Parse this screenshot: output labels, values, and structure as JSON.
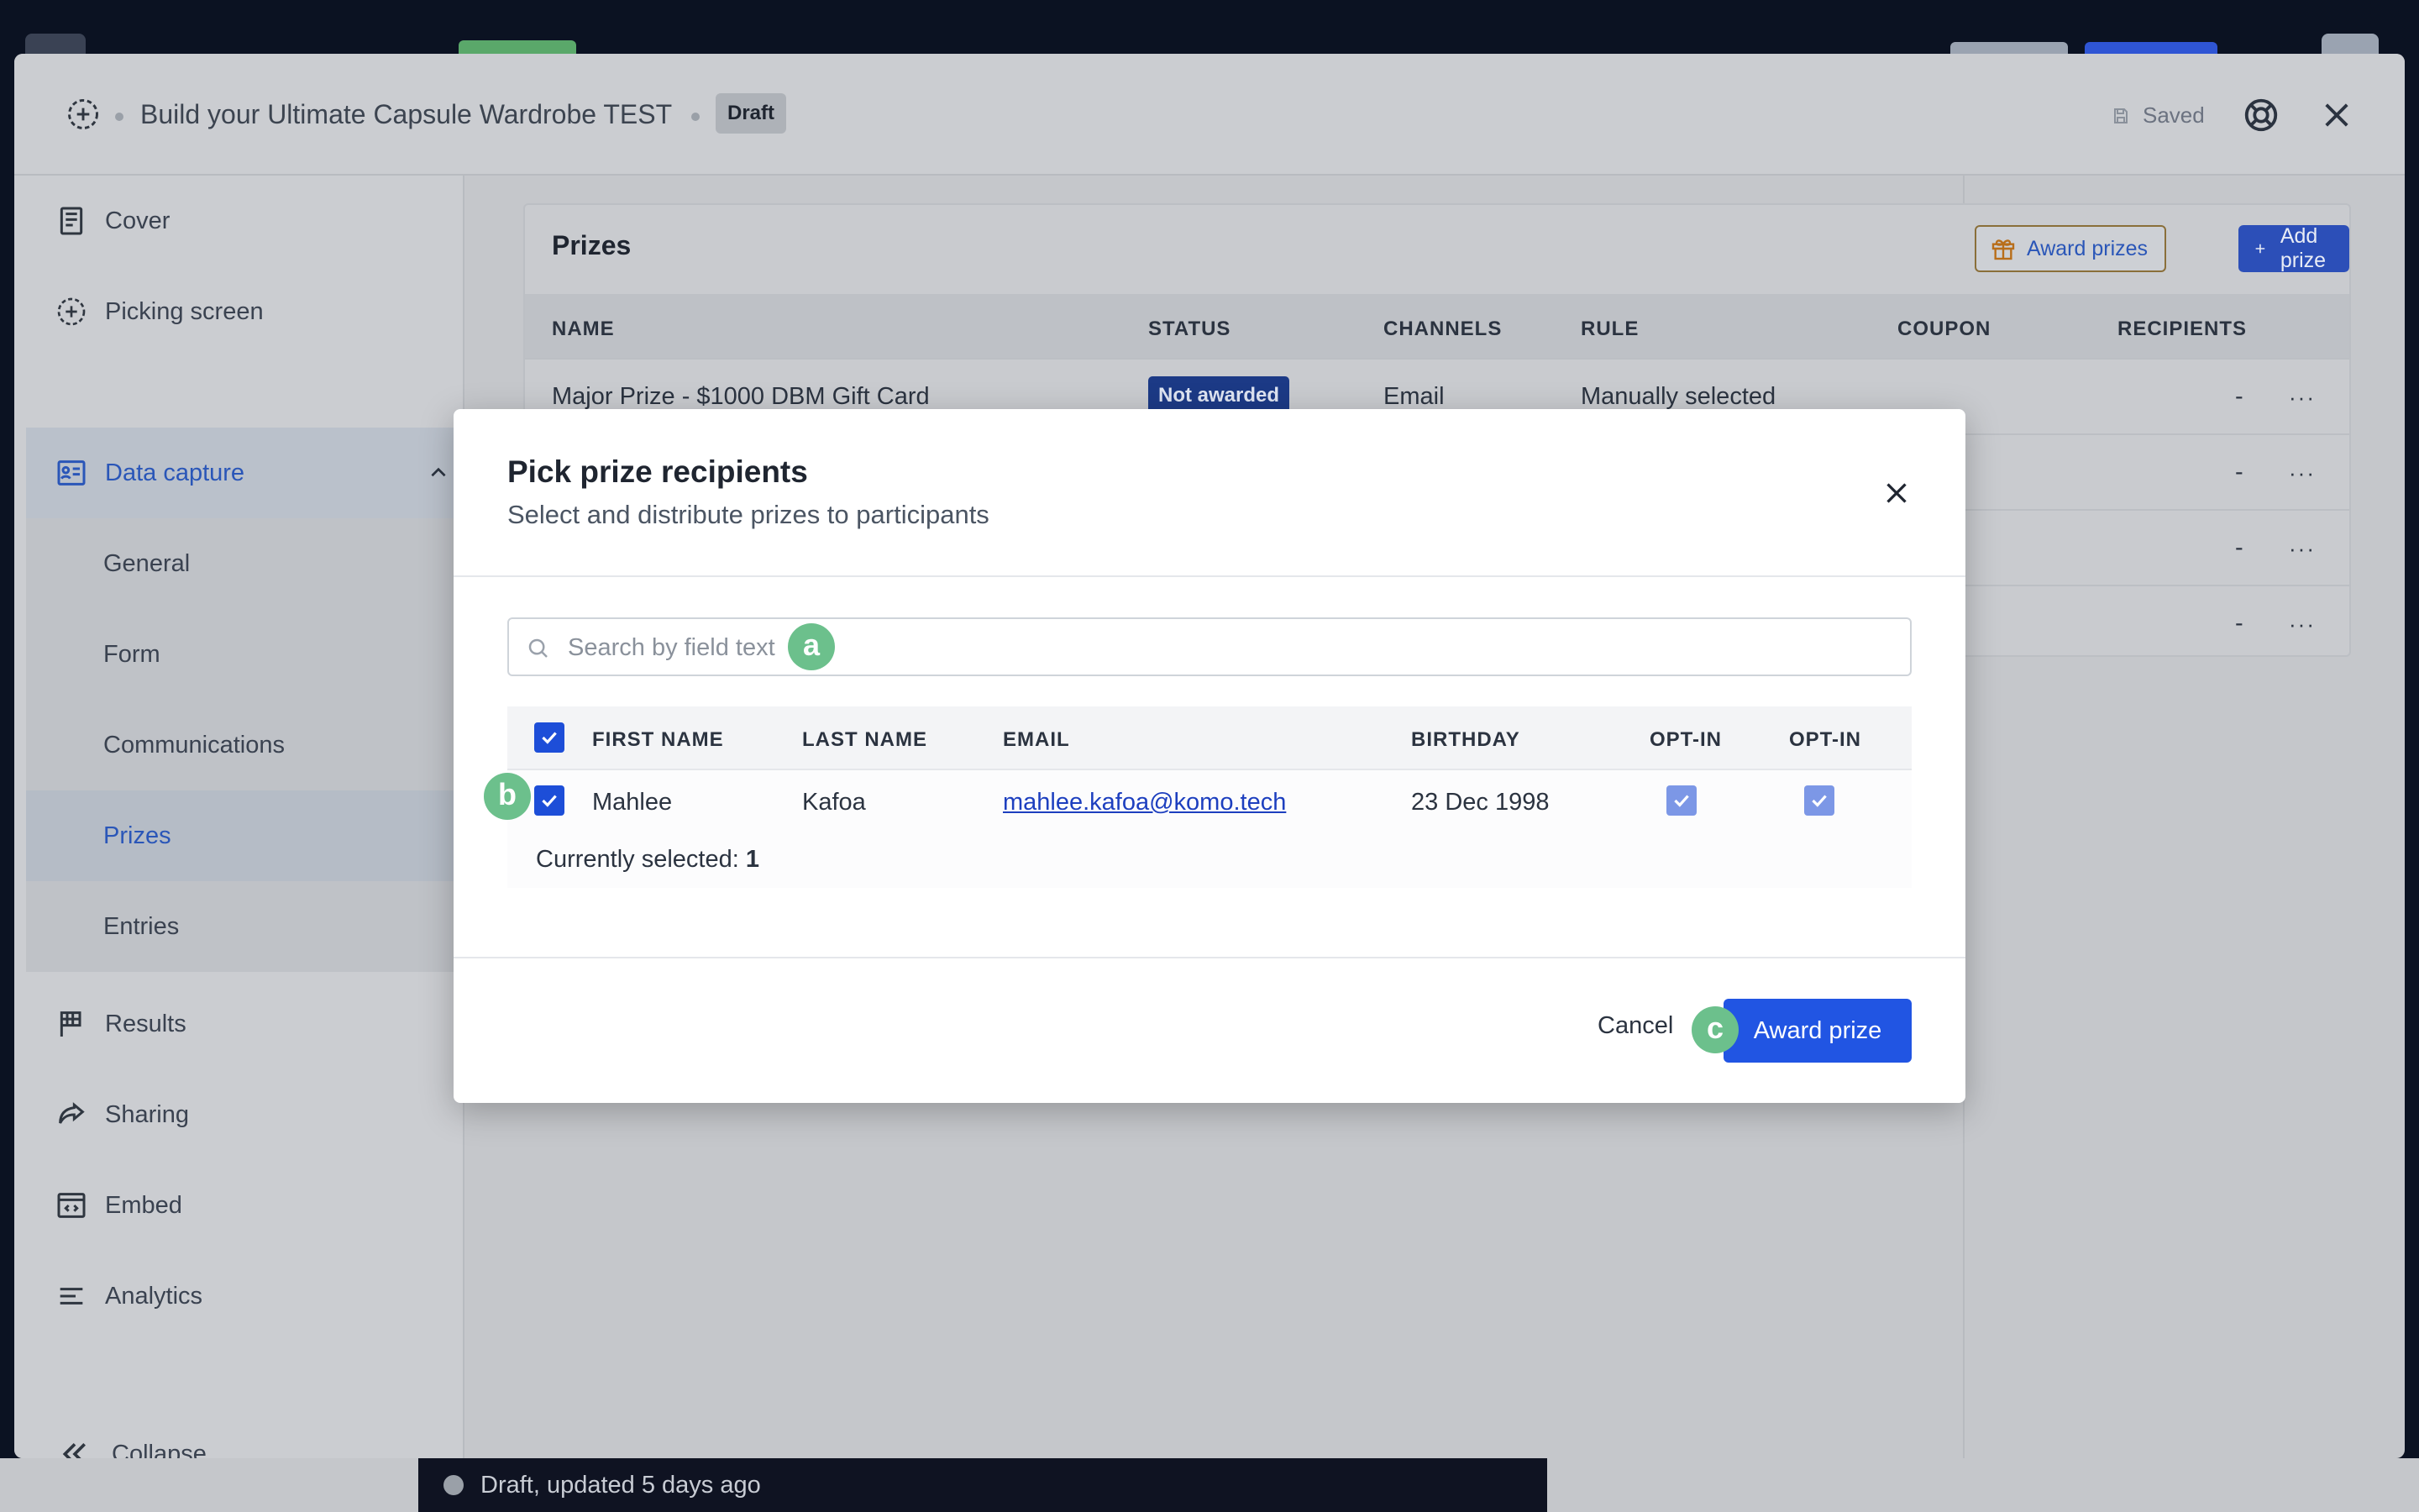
{
  "window": {
    "title": "Build your Ultimate Capsule Wardrobe TEST",
    "badge": "Draft",
    "saved_label": "Saved"
  },
  "sidebar": {
    "items": [
      {
        "label": "Cover",
        "icon": "cover-icon"
      },
      {
        "label": "Picking screen",
        "icon": "picking-screen-icon"
      },
      {
        "label": "Data capture",
        "icon": "data-capture-icon"
      },
      {
        "label": "General"
      },
      {
        "label": "Form"
      },
      {
        "label": "Communications"
      },
      {
        "label": "Prizes"
      },
      {
        "label": "Entries"
      },
      {
        "label": "Results",
        "icon": "flag-icon"
      },
      {
        "label": "Sharing",
        "icon": "share-icon"
      },
      {
        "label": "Embed",
        "icon": "embed-icon"
      },
      {
        "label": "Analytics",
        "icon": "analytics-icon"
      }
    ],
    "collapse_label": "Collapse",
    "active_item": "Prizes"
  },
  "prizes": {
    "title": "Prizes",
    "award_button": "Award prizes",
    "add_button": "Add prize",
    "columns": [
      "NAME",
      "STATUS",
      "CHANNELS",
      "RULE",
      "COUPON",
      "RECIPIENTS"
    ],
    "rows": [
      {
        "name": "Major Prize - $1000 DBM Gift Card",
        "status": "Not awarded",
        "channels": "Email",
        "rule": "Manually selected",
        "coupon": "",
        "recipients": "-"
      },
      {
        "recipients": "-"
      },
      {
        "recipients": "-"
      },
      {
        "recipients": "-"
      }
    ],
    "row_menu": "···"
  },
  "status_bar": {
    "text": "Draft, updated 5 days ago"
  },
  "modal": {
    "title": "Pick prize recipients",
    "subtitle": "Select and distribute prizes to participants",
    "search_placeholder": "Search by field text",
    "columns": [
      "FIRST NAME",
      "LAST NAME",
      "EMAIL",
      "BIRTHDAY",
      "OPT-IN",
      "OPT-IN"
    ],
    "rows": [
      {
        "first_name": "Mahlee",
        "last_name": "Kafoa",
        "email": "mahlee.kafoa@komo.tech",
        "birthday": "23 Dec 1998",
        "opt_in_1": true,
        "opt_in_2": true,
        "selected": true
      }
    ],
    "selected_label": "Currently selected:",
    "selected_count": "1",
    "cancel_label": "Cancel",
    "award_label": "Award prize",
    "markers": {
      "a": "a",
      "b": "b",
      "c": "c"
    }
  },
  "colors": {
    "accent": "#2155e3",
    "marker": "#6cc08c",
    "status_not_awarded": "#1c3a86"
  }
}
